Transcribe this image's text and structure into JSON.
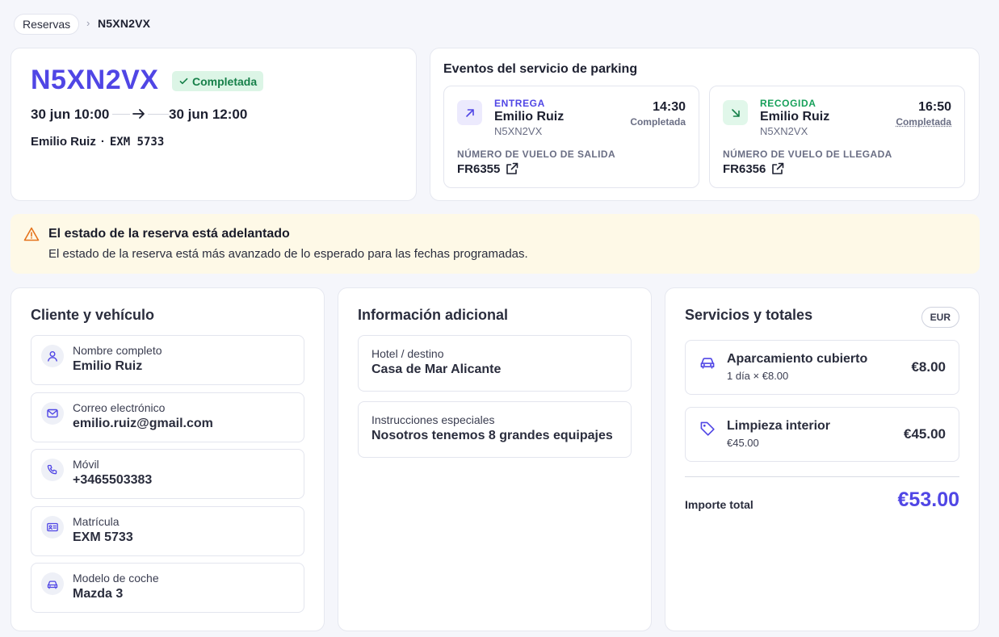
{
  "breadcrumb": {
    "root": "Reservas",
    "separator": "›",
    "current": "N5XN2VX"
  },
  "booking": {
    "code": "N5XN2VX",
    "status": "Completada",
    "date_from": "30 jun 10:00",
    "date_to": "30 jun 12:00",
    "customer": "Emilio Ruiz",
    "dot": "·",
    "plate": "EXM 5733"
  },
  "events": {
    "title": "Eventos del servicio de parking",
    "delivery": {
      "type": "ENTREGA",
      "name": "Emilio Ruiz",
      "code": "N5XN2VX",
      "time": "14:30",
      "status": "Completada",
      "flight_label": "NÚMERO DE VUELO DE SALIDA",
      "flight": "FR6355"
    },
    "pickup": {
      "type": "RECOGIDA",
      "name": "Emilio Ruiz",
      "code": "N5XN2VX",
      "time": "16:50",
      "status": "Completada",
      "flight_label": "NÚMERO DE VUELO DE LLEGADA",
      "flight": "FR6356"
    }
  },
  "warning": {
    "title": "El estado de la reserva está adelantado",
    "text": "El estado de la reserva está más avanzado de lo esperado para las fechas programadas."
  },
  "client": {
    "title": "Cliente y vehículo",
    "fields": [
      {
        "label": "Nombre completo",
        "value": "Emilio Ruiz",
        "icon": "user-icon"
      },
      {
        "label": "Correo electrónico",
        "value": "emilio.ruiz@gmail.com",
        "icon": "mail-icon"
      },
      {
        "label": "Móvil",
        "value": "+3465503383",
        "icon": "phone-icon"
      },
      {
        "label": "Matrícula",
        "value": "EXM 5733",
        "icon": "id-card-icon"
      },
      {
        "label": "Modelo de coche",
        "value": "Mazda 3",
        "icon": "car-icon"
      }
    ]
  },
  "info": {
    "title": "Información adicional",
    "fields": [
      {
        "label": "Hotel / destino",
        "value": "Casa de Mar Alicante"
      },
      {
        "label": "Instrucciones especiales",
        "value": "Nosotros tenemos 8 grandes equipajes"
      }
    ]
  },
  "services": {
    "title": "Servicios y totales",
    "currency": "EUR",
    "items": [
      {
        "name": "Aparcamiento cubierto",
        "sub": "1 día × €8.00",
        "price": "€8.00",
        "icon": "car-icon"
      },
      {
        "name": "Limpieza interior",
        "sub": "€45.00",
        "price": "€45.00",
        "icon": "tag-icon"
      }
    ],
    "total_label": "Importe total",
    "total_value": "€53.00"
  },
  "colors": {
    "accent": "#5046e5",
    "success": "#17804a",
    "success_bg": "#dcf5e6",
    "warning_bg": "#fef9e7",
    "warning_icon": "#e5731c"
  }
}
